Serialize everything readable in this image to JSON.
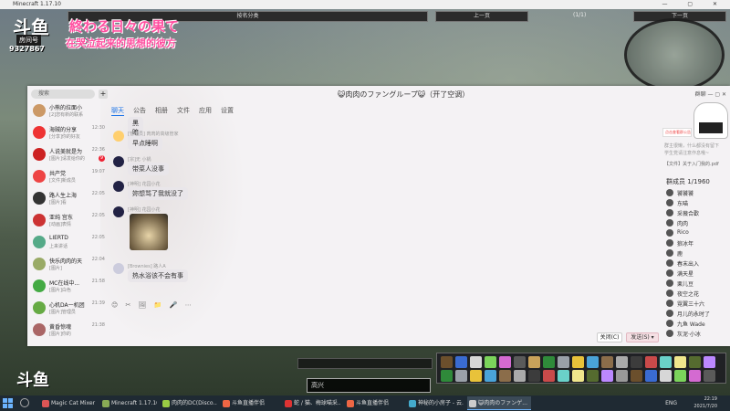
{
  "minecraft": {
    "window_title": "Minecraft 1.17.10",
    "sort_label": "按名分类",
    "prev_label": "上一页",
    "page_indicator": "(1/1)",
    "next_label": "下一页",
    "chat_input_text": "高兴"
  },
  "douyu": {
    "logo_text": "斗鱼",
    "room_label": "房间号",
    "room_number": "9327867",
    "stream_title": "終わる日々の果て",
    "stream_subtitle": "在哭泣起来的思想的彼方"
  },
  "qq": {
    "window_title": "😺肉肉のファングループ😺（开了空调）",
    "titlebar_right": "群聊",
    "search_placeholder": "搜索",
    "add_icon": "+",
    "sessions": [
      {
        "name": "小熊的拉面小",
        "preview": "[2]您有新的联系",
        "time": "",
        "badge": "",
        "avatar_color": "#c96"
      },
      {
        "name": "海贼的分享",
        "preview": "[分享]你的好友",
        "time": "12:30",
        "badge": "",
        "avatar_color": "#e33"
      },
      {
        "name": "人说美就是为",
        "preview": "[图片]请发给你的",
        "time": "22:36",
        "badge": "9",
        "avatar_color": "#c22"
      },
      {
        "name": "共产党",
        "preview": "[文件]新成员",
        "time": "19:07",
        "badge": "",
        "avatar_color": "#e44"
      },
      {
        "name": "路人生上海",
        "preview": "[图片]看",
        "time": "22:05",
        "badge": "",
        "avatar_color": "#333"
      },
      {
        "name": "亚纯 宫东",
        "preview": "[动画]表情",
        "time": "22:05",
        "badge": "",
        "avatar_color": "#c33"
      },
      {
        "name": "LIERTD",
        "preview": "上来讲话",
        "time": "22:05",
        "badge": "",
        "avatar_color": "#5a8"
      },
      {
        "name": "快乐肉肉的天",
        "preview": "[图片]",
        "time": "22:04",
        "badge": "",
        "avatar_color": "#9a6"
      },
      {
        "name": "MC在线中...",
        "preview": "[图片]白色",
        "time": "21:58",
        "badge": "",
        "avatar_color": "#4a4"
      },
      {
        "name": "心机DA一机团",
        "preview": "[图片]管理员",
        "time": "21:39",
        "badge": "",
        "avatar_color": "#6a4"
      },
      {
        "name": "黄昏惊魂",
        "preview": "[图片]你的",
        "time": "21:38",
        "badge": "",
        "avatar_color": "#a66"
      }
    ],
    "tabs": [
      "聊天",
      "公告",
      "相册",
      "文件",
      "应用",
      "设置"
    ],
    "messages": [
      {
        "sender": "",
        "text": "黑暗寒",
        "avatar_color": "#fff"
      },
      {
        "sender": "[管理员] 肉肉的高级管家",
        "text": "早点睡啊",
        "avatar_color": "#ffcf6e"
      },
      {
        "sender": "[宗]无 小锅",
        "text": "带菜人没事",
        "avatar_color": "#224"
      },
      {
        "sender": "[神明] 花园小花",
        "text": "妳想骂了我就没了",
        "avatar_color": "#224"
      },
      {
        "sender": "[神明] 花园小花",
        "text": "",
        "avatar_color": "#224"
      },
      {
        "sender": "[Brownies] 路人A",
        "text": "热水浴该不会有事",
        "avatar_color": "#ccd"
      }
    ],
    "toolbar_icons": [
      "😊",
      "✂",
      "🖼",
      "📁",
      "🎤",
      "⋯"
    ],
    "close_label": "关闭(C)",
    "send_label": "发送(S) ▾",
    "announcement": {
      "card_text": "点击查看群公告",
      "text1": "群主很懒，什么都没有留下",
      "text2": "学生党请注意作息哦~",
      "file": "【文件】关于入门我的.pdf"
    },
    "member_count": "群成员 1/1960",
    "members": [
      "饕饕饕",
      "东喵",
      "采薇合歡",
      "肉肉",
      "Rico",
      "狼冰年",
      "鹿",
      "春末出入",
      "满天星",
      "栗儿豆",
      "夜空之花",
      "霓翼三十六",
      "月儿的永时了",
      "九鱼 Wade",
      "灰泥·小冰"
    ]
  },
  "taskbar": {
    "tasks": [
      {
        "label": "Magic Cat Mixer",
        "color": "#d55"
      },
      {
        "label": "Minecraft 1.17.10",
        "color": "#8a5"
      },
      {
        "label": "肉肉的DC(Disco...",
        "color": "#9c4"
      },
      {
        "label": "斗鱼直播伴侣",
        "color": "#e64"
      },
      {
        "label": "蛇 / 猫、梅球喵采...",
        "color": "#d33"
      },
      {
        "label": "斗鱼直播伴侣",
        "color": "#e64"
      },
      {
        "label": "神秘的小房子 - 云...",
        "color": "#4ac"
      },
      {
        "label": "😺肉肉のファンゲ...",
        "color": "#ccc"
      }
    ],
    "lang": "ENG",
    "time": "22:19",
    "date": "2021/7/20"
  }
}
